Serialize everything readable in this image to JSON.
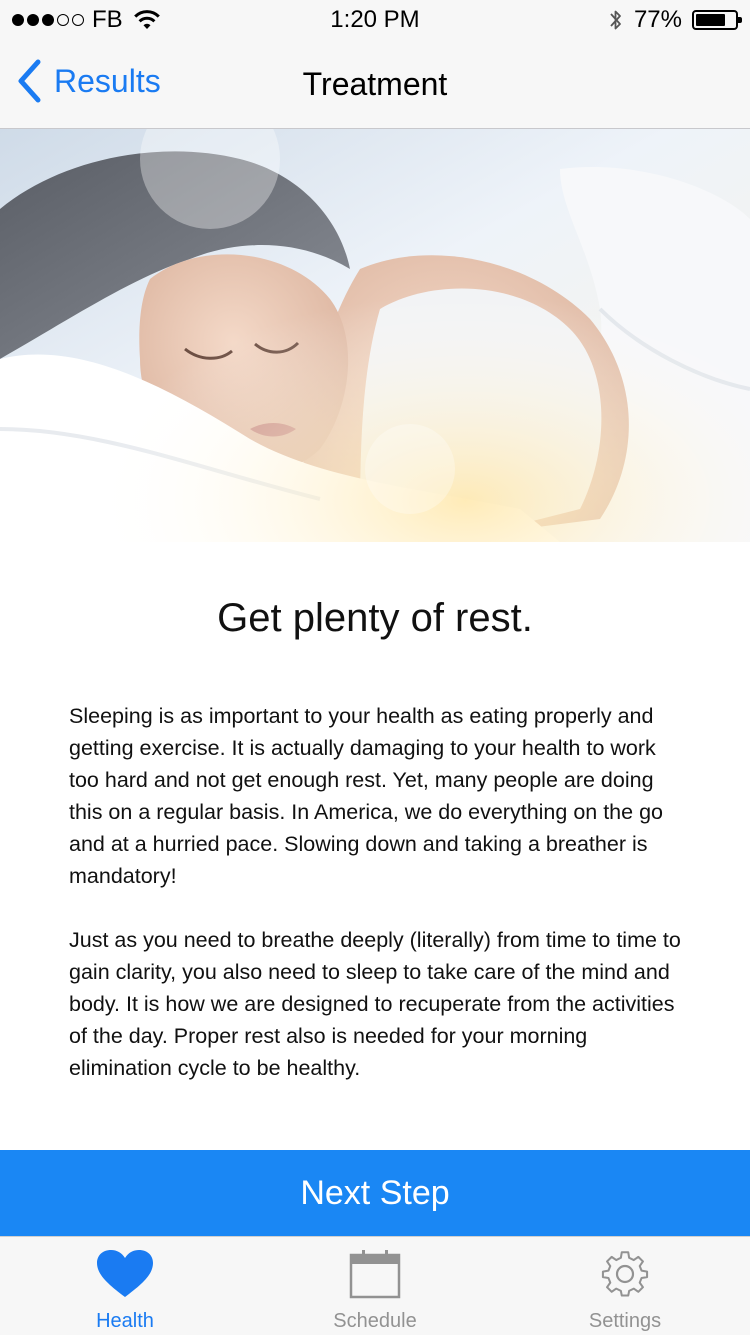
{
  "status_bar": {
    "carrier": "FB",
    "time": "1:20 PM",
    "battery": "77%",
    "battery_level": 0.77,
    "signal_bars_filled": 3,
    "signal_bars_total": 5
  },
  "nav": {
    "back_label": "Results",
    "title": "Treatment"
  },
  "hero": {
    "icon": "sleeping-woman-photo"
  },
  "content": {
    "headline": "Get plenty of rest.",
    "paragraph_1": "Sleeping is as important to your health as eating properly and getting exercise. It is actually damaging to your health to work too hard and not get enough rest. Yet, many people are doing this on a regular basis. In America, we do everything on the go and at a hurried pace. Slowing down and taking a breather is mandatory!",
    "paragraph_2": "Just as you need to breathe deeply (literally) from time to time to gain clarity, you also need to sleep to take care of the mind and body. It is how we are designed to recuperate from the activities of the day. Proper rest also is needed for your morning elimination cycle to be healthy."
  },
  "cta": {
    "label": "Next Step"
  },
  "tabs": [
    {
      "label": "Health",
      "icon": "heart-icon",
      "active": true
    },
    {
      "label": "Schedule",
      "icon": "calendar-icon",
      "active": false
    },
    {
      "label": "Settings",
      "icon": "gear-icon",
      "active": false
    }
  ],
  "colors": {
    "accent": "#1a7bf2",
    "cta_background": "#1a87f4",
    "inactive_tab": "#929292",
    "bar_background": "#f7f7f7"
  }
}
